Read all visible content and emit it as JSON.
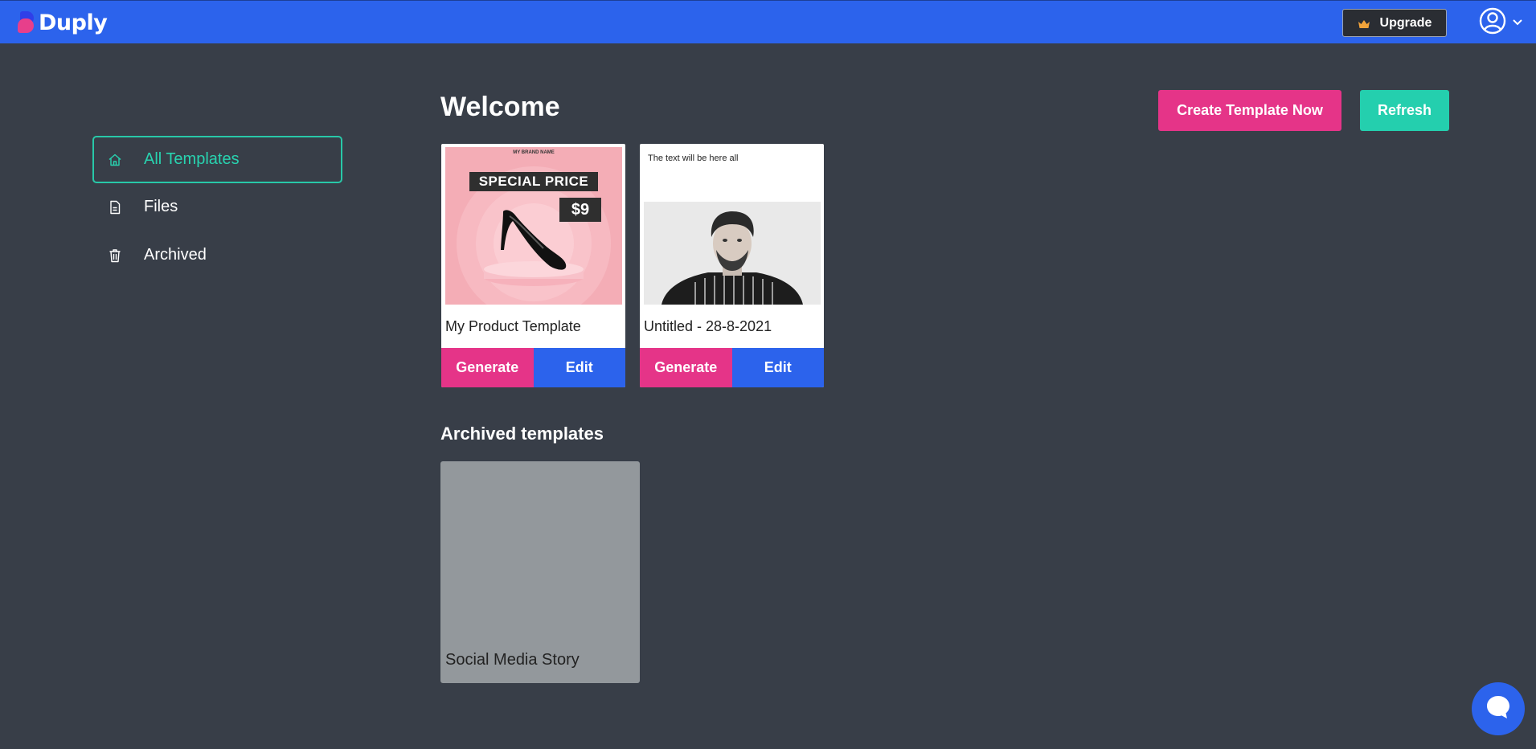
{
  "app": {
    "name": "Duply"
  },
  "header": {
    "upgrade_label": "Upgrade"
  },
  "sidebar": {
    "items": [
      {
        "label": "All Templates",
        "icon": "home-icon",
        "active": true
      },
      {
        "label": "Files",
        "icon": "file-icon",
        "active": false
      },
      {
        "label": "Archived",
        "icon": "trash-icon",
        "active": false
      }
    ]
  },
  "main": {
    "heading": "Welcome",
    "create_label": "Create Template Now",
    "refresh_label": "Refresh",
    "templates": [
      {
        "title": "My Product Template",
        "thumb": {
          "brand": "MY BRAND NAME",
          "banner": "SPECIAL PRICE",
          "price": "$9"
        },
        "generate_label": "Generate",
        "edit_label": "Edit"
      },
      {
        "title": "Untitled - 28-8-2021",
        "thumb": {
          "text": "The text will be here all"
        },
        "generate_label": "Generate",
        "edit_label": "Edit"
      }
    ],
    "archived_heading": "Archived templates",
    "archived": [
      {
        "title": "Social Media Story"
      }
    ]
  },
  "colors": {
    "header": "#2c63ec",
    "background": "#383e48",
    "accent_pink": "#e53488",
    "accent_teal": "#24cfae",
    "accent_blue": "#2c63ec"
  }
}
